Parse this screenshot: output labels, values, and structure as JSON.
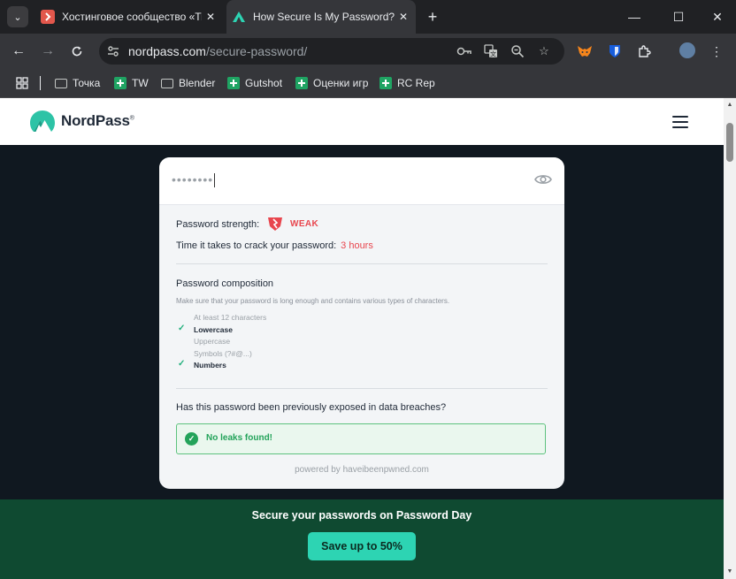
{
  "browser": {
    "tabs": [
      {
        "title": "Хостинговое сообщество «Tim",
        "active": false,
        "favicon_color": "#e2574c"
      },
      {
        "title": "How Secure Is My Password? | N",
        "active": true,
        "favicon_color": "#2dd4b3"
      }
    ],
    "url_domain": "nordpass.com",
    "url_path": "/secure-password/",
    "bookmarks": [
      {
        "label": "Точка",
        "icon": "folder-icon"
      },
      {
        "label": "TW",
        "icon": "sheets-icon"
      },
      {
        "label": "Blender",
        "icon": "folder-icon"
      },
      {
        "label": "Gutshot",
        "icon": "sheets-icon"
      },
      {
        "label": "Оценки игр",
        "icon": "sheets-icon"
      },
      {
        "label": "RC Rep",
        "icon": "sheets-icon"
      }
    ]
  },
  "site": {
    "brand": "NordPass",
    "brand_mark": "®"
  },
  "checker": {
    "password_masked": "••••••••",
    "strength_label": "Password strength:",
    "strength_value": "WEAK",
    "crack_label": "Time it takes to crack your password:",
    "crack_value": "3 hours",
    "composition_title": "Password composition",
    "composition_desc": "Make sure that your password is long enough and contains various types of characters.",
    "requirements": [
      {
        "label": "At least 12 characters",
        "met": false
      },
      {
        "label": "Lowercase",
        "met": true
      },
      {
        "label": "Uppercase",
        "met": false
      },
      {
        "label": "Symbols (?#@...)",
        "met": false
      },
      {
        "label": "Numbers",
        "met": true
      }
    ],
    "breach_question": "Has this password been previously exposed in data breaches?",
    "breach_result": "No leaks found!",
    "powered_by": "powered by haveibeenpwned.com"
  },
  "promo": {
    "title": "Secure your passwords on Password Day",
    "button": "Save up to 50%"
  },
  "colors": {
    "weak": "#e8464e",
    "success": "#23a35a",
    "accent": "#2dd4b3",
    "promo_bg": "#0f4a31"
  }
}
